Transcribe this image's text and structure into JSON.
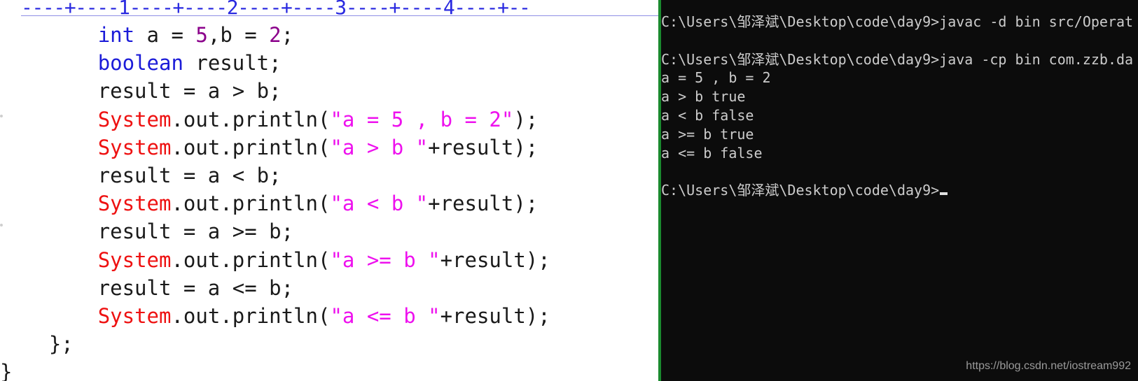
{
  "editor": {
    "ruler": "----+----1----+----2----+----3----+----4----+--",
    "lines": [
      [
        {
          "t": "        "
        },
        {
          "t": "int",
          "c": "kw"
        },
        {
          "t": " a = "
        },
        {
          "t": "5",
          "c": "num"
        },
        {
          "t": ",b = "
        },
        {
          "t": "2",
          "c": "num"
        },
        {
          "t": ";"
        }
      ],
      [
        {
          "t": "        "
        },
        {
          "t": "boolean",
          "c": "kw"
        },
        {
          "t": " result;"
        }
      ],
      [
        {
          "t": "        result = a > b;"
        }
      ],
      [
        {
          "t": "        "
        },
        {
          "t": "System",
          "c": "sys"
        },
        {
          "t": ".out.println("
        },
        {
          "t": "\"a = 5 , b = 2\"",
          "c": "str"
        },
        {
          "t": ");"
        }
      ],
      [
        {
          "t": "        "
        },
        {
          "t": "System",
          "c": "sys"
        },
        {
          "t": ".out.println("
        },
        {
          "t": "\"a > b \"",
          "c": "str"
        },
        {
          "t": "+result);"
        }
      ],
      [
        {
          "t": "        result = a < b;"
        }
      ],
      [
        {
          "t": "        "
        },
        {
          "t": "System",
          "c": "sys"
        },
        {
          "t": ".out.println("
        },
        {
          "t": "\"a < b \"",
          "c": "str"
        },
        {
          "t": "+result);"
        }
      ],
      [
        {
          "t": "        result = a >= b;"
        }
      ],
      [
        {
          "t": "        "
        },
        {
          "t": "System",
          "c": "sys"
        },
        {
          "t": ".out.println("
        },
        {
          "t": "\"a >= b \"",
          "c": "str"
        },
        {
          "t": "+result);"
        }
      ],
      [
        {
          "t": "        result = a <= b;"
        }
      ],
      [
        {
          "t": "        "
        },
        {
          "t": "System",
          "c": "sys"
        },
        {
          "t": ".out.println("
        },
        {
          "t": "\"a <= b \"",
          "c": "str"
        },
        {
          "t": "+result);"
        }
      ],
      [
        {
          "t": "    };"
        }
      ],
      [
        {
          "t": "}"
        }
      ]
    ]
  },
  "console": {
    "lines": [
      "C:\\Users\\邹泽斌\\Desktop\\code\\day9>javac -d bin src/Operat",
      "",
      "C:\\Users\\邹泽斌\\Desktop\\code\\day9>java -cp bin com.zzb.da",
      "a = 5 , b = 2",
      "a > b true",
      "a < b false",
      "a >= b true",
      "a <= b false",
      "",
      "C:\\Users\\邹泽斌\\Desktop\\code\\day9>"
    ],
    "cursor_line": 9
  },
  "watermark": "https://blog.csdn.net/iostream992",
  "colors": {
    "keyword": "#1b1bd8",
    "system": "#ee1111",
    "string": "#ee11ee",
    "number": "#8b008b",
    "console_bg": "#0c0c0c",
    "console_fg": "#cccccc"
  }
}
